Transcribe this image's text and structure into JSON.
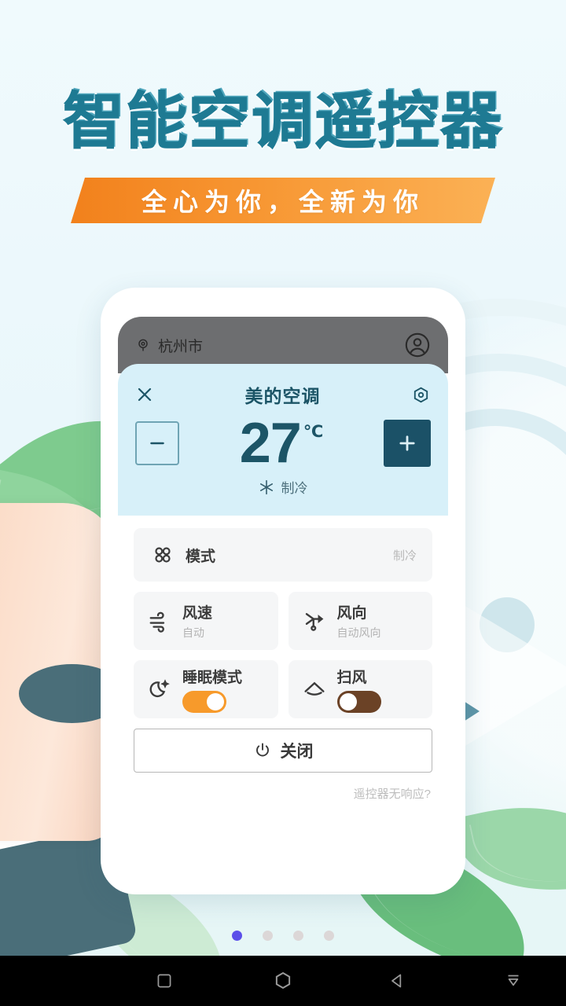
{
  "promo": {
    "headline": "智能空调遥控器",
    "banner": "全心为你，全新为你",
    "accent_teal": "#1E7A93",
    "accent_orange": "#F2811C"
  },
  "phone": {
    "appbar": {
      "location_icon": "location-pin-icon",
      "location": "杭州市",
      "account_icon": "account-circle-icon"
    },
    "hero": {
      "close_icon": "close-icon",
      "device_name": "美的空调",
      "settings_icon": "target-settings-icon",
      "minus_label": "−",
      "plus_label": "+",
      "temperature": "27",
      "unit": "℃",
      "mode_icon": "snowflake-icon",
      "mode_text": "制冷",
      "bg_color": "#D7F0F9",
      "plus_color": "#1B5167"
    },
    "controls": [
      {
        "icon": "clover-mode-icon",
        "label": "模式",
        "value": "制冷"
      },
      {
        "icon": "fan-speed-icon",
        "label": "风速",
        "sub": "自动"
      },
      {
        "icon": "weathervane-icon",
        "label": "风向",
        "sub": "自动风向"
      },
      {
        "icon": "moon-sleep-icon",
        "label": "睡眠模式",
        "toggle": "on",
        "toggle_color": "#F79A2B"
      },
      {
        "icon": "swing-wind-icon",
        "label": "扫风",
        "toggle": "off",
        "toggle_color": "#6B4226"
      }
    ],
    "power": {
      "icon": "power-icon",
      "label": "关闭"
    },
    "help_link": "遥控器无响应?"
  },
  "pager": {
    "count": 4,
    "active_index": 0,
    "active_color": "#5B4FE9",
    "inactive_color": "#DCD7D7"
  },
  "navbar": {
    "recents_icon": "square-recents-icon",
    "home_icon": "hexagon-home-icon",
    "back_icon": "triangle-back-icon",
    "hide_icon": "hide-keyboard-icon"
  }
}
